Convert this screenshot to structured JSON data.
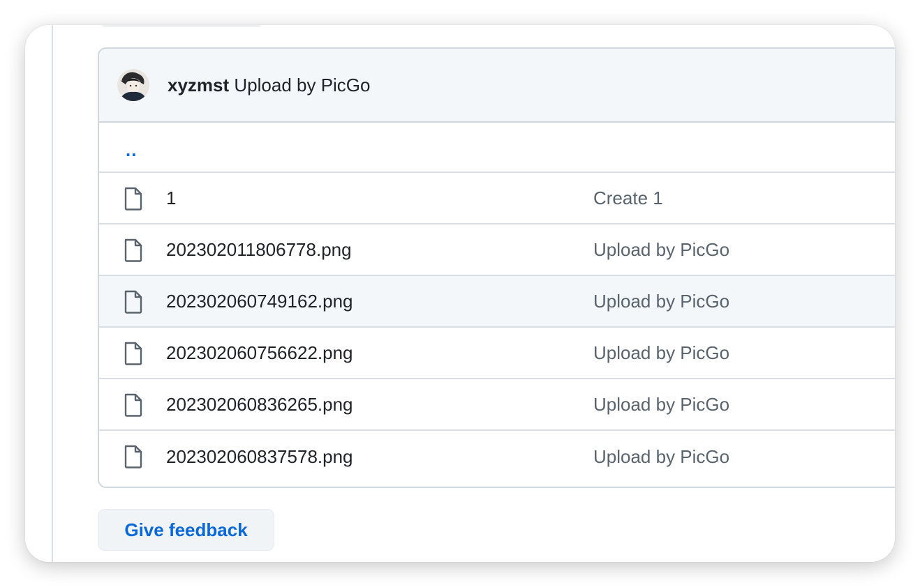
{
  "commit": {
    "author": "xyzmst",
    "message": "Upload by PicGo"
  },
  "parent_link": "..",
  "files": [
    {
      "name": "1",
      "commit_message": "Create 1",
      "icon": "file-icon"
    },
    {
      "name": "202302011806778.png",
      "commit_message": "Upload by PicGo",
      "icon": "file-icon"
    },
    {
      "name": "202302060749162.png",
      "commit_message": "Upload by PicGo",
      "icon": "file-icon"
    },
    {
      "name": "202302060756622.png",
      "commit_message": "Upload by PicGo",
      "icon": "file-icon"
    },
    {
      "name": "202302060836265.png",
      "commit_message": "Upload by PicGo",
      "icon": "file-icon"
    },
    {
      "name": "202302060837578.png",
      "commit_message": "Upload by PicGo",
      "icon": "file-icon"
    }
  ],
  "feedback": {
    "label": "Give feedback"
  },
  "colors": {
    "link": "#0969da",
    "border": "#d0d7de",
    "header_bg": "#f4f7fa",
    "text": "#1f2328",
    "muted": "#59636e"
  }
}
